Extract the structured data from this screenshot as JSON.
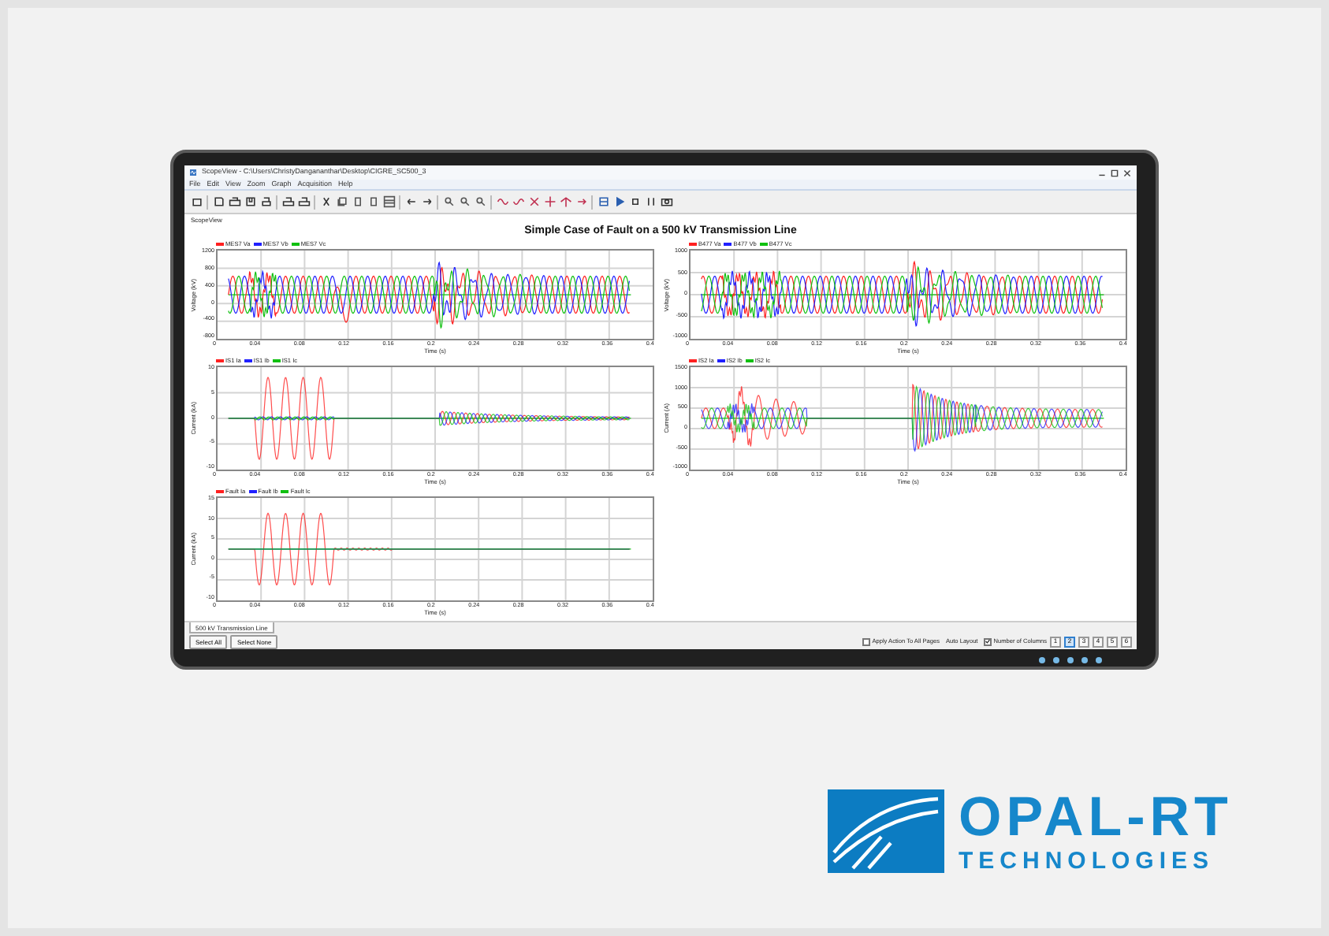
{
  "window": {
    "title": "ScopeView - C:\\Users\\ChristyDangananthar\\Desktop\\CIGRE_SC500_3"
  },
  "menu": [
    "File",
    "Edit",
    "View",
    "Zoom",
    "Graph",
    "Acquisition",
    "Help"
  ],
  "pane_label": "ScopeView",
  "chart_title": "Simple Case of Fault on a 500 kV Transmission Line",
  "plots": [
    {
      "kind": "voltage",
      "series": [
        {
          "name": "MES7 Va",
          "color": "#ff2020"
        },
        {
          "name": "MES7 Vb",
          "color": "#2020ff"
        },
        {
          "name": "MES7 Vc",
          "color": "#10c010"
        }
      ],
      "ylabel": "Voltage (kV)",
      "yticks": [
        "1200",
        "800",
        "400",
        "0",
        "-400",
        "-800"
      ],
      "xticks": [
        "0",
        "0.04",
        "0.08",
        "0.12",
        "0.16",
        "0.2",
        "0.24",
        "0.28",
        "0.32",
        "0.36",
        "0.4"
      ],
      "xlabel": "Time (s)"
    },
    {
      "kind": "voltage",
      "series": [
        {
          "name": "B477 Va",
          "color": "#ff2020"
        },
        {
          "name": "B477 Vb",
          "color": "#2020ff"
        },
        {
          "name": "B477 Vc",
          "color": "#10c010"
        }
      ],
      "ylabel": "Voltage (kV)",
      "yticks": [
        "1000",
        "500",
        "0",
        "-500",
        "-1000"
      ],
      "xticks": [
        "0",
        "0.04",
        "0.08",
        "0.12",
        "0.16",
        "0.2",
        "0.24",
        "0.28",
        "0.32",
        "0.36",
        "0.4"
      ],
      "xlabel": "Time (s)"
    },
    {
      "kind": "source_current",
      "series": [
        {
          "name": "IS1 Ia",
          "color": "#ff2020"
        },
        {
          "name": "IS1 Ib",
          "color": "#2020ff"
        },
        {
          "name": "IS1 Ic",
          "color": "#10c010"
        }
      ],
      "ylabel": "Current (kA)",
      "yticks": [
        "10",
        "5",
        "0",
        "-5",
        "-10"
      ],
      "xticks": [
        "0",
        "0.04",
        "0.08",
        "0.12",
        "0.16",
        "0.2",
        "0.24",
        "0.28",
        "0.32",
        "0.36",
        "0.4"
      ],
      "xlabel": "Time (s)"
    },
    {
      "kind": "load_current",
      "series": [
        {
          "name": "IS2 Ia",
          "color": "#ff2020"
        },
        {
          "name": "IS2 Ib",
          "color": "#2020ff"
        },
        {
          "name": "IS2 Ic",
          "color": "#10c010"
        }
      ],
      "ylabel": "Current (A)",
      "yticks": [
        "1500",
        "1000",
        "500",
        "0",
        "-500",
        "-1000"
      ],
      "xticks": [
        "0",
        "0.04",
        "0.08",
        "0.12",
        "0.16",
        "0.2",
        "0.24",
        "0.28",
        "0.32",
        "0.36",
        "0.4"
      ],
      "xlabel": "Time (s)"
    },
    {
      "kind": "fault_current",
      "series": [
        {
          "name": "Fault Ia",
          "color": "#ff2020"
        },
        {
          "name": "Fault Ib",
          "color": "#2020ff"
        },
        {
          "name": "Fault Ic",
          "color": "#10c010"
        }
      ],
      "ylabel": "Current (kA)",
      "yticks": [
        "15",
        "10",
        "5",
        "0",
        "-5",
        "-10"
      ],
      "xticks": [
        "0",
        "0.04",
        "0.08",
        "0.12",
        "0.16",
        "0.2",
        "0.24",
        "0.28",
        "0.32",
        "0.36",
        "0.4"
      ],
      "xlabel": "Time (s)"
    }
  ],
  "tabs": [
    {
      "label": "500 kV Transmission Line",
      "selected": true
    }
  ],
  "buttons": [
    "Select All",
    "Select None"
  ],
  "options": [
    {
      "kind": "checkbox",
      "label": "Apply Action To All Pages",
      "checked": false
    },
    {
      "kind": "text",
      "label": "Auto Layout"
    },
    {
      "kind": "checkbox",
      "label": "Number of Columns",
      "checked": true
    }
  ],
  "pages": [
    {
      "label": "1",
      "selected": false
    },
    {
      "label": "2",
      "selected": true
    },
    {
      "label": "3",
      "selected": false
    },
    {
      "label": "4",
      "selected": false
    },
    {
      "label": "5",
      "selected": false
    },
    {
      "label": "6",
      "selected": false
    }
  ],
  "logo": {
    "name": "OPAL-RT",
    "tagline": "TECHNOLOGIES"
  }
}
